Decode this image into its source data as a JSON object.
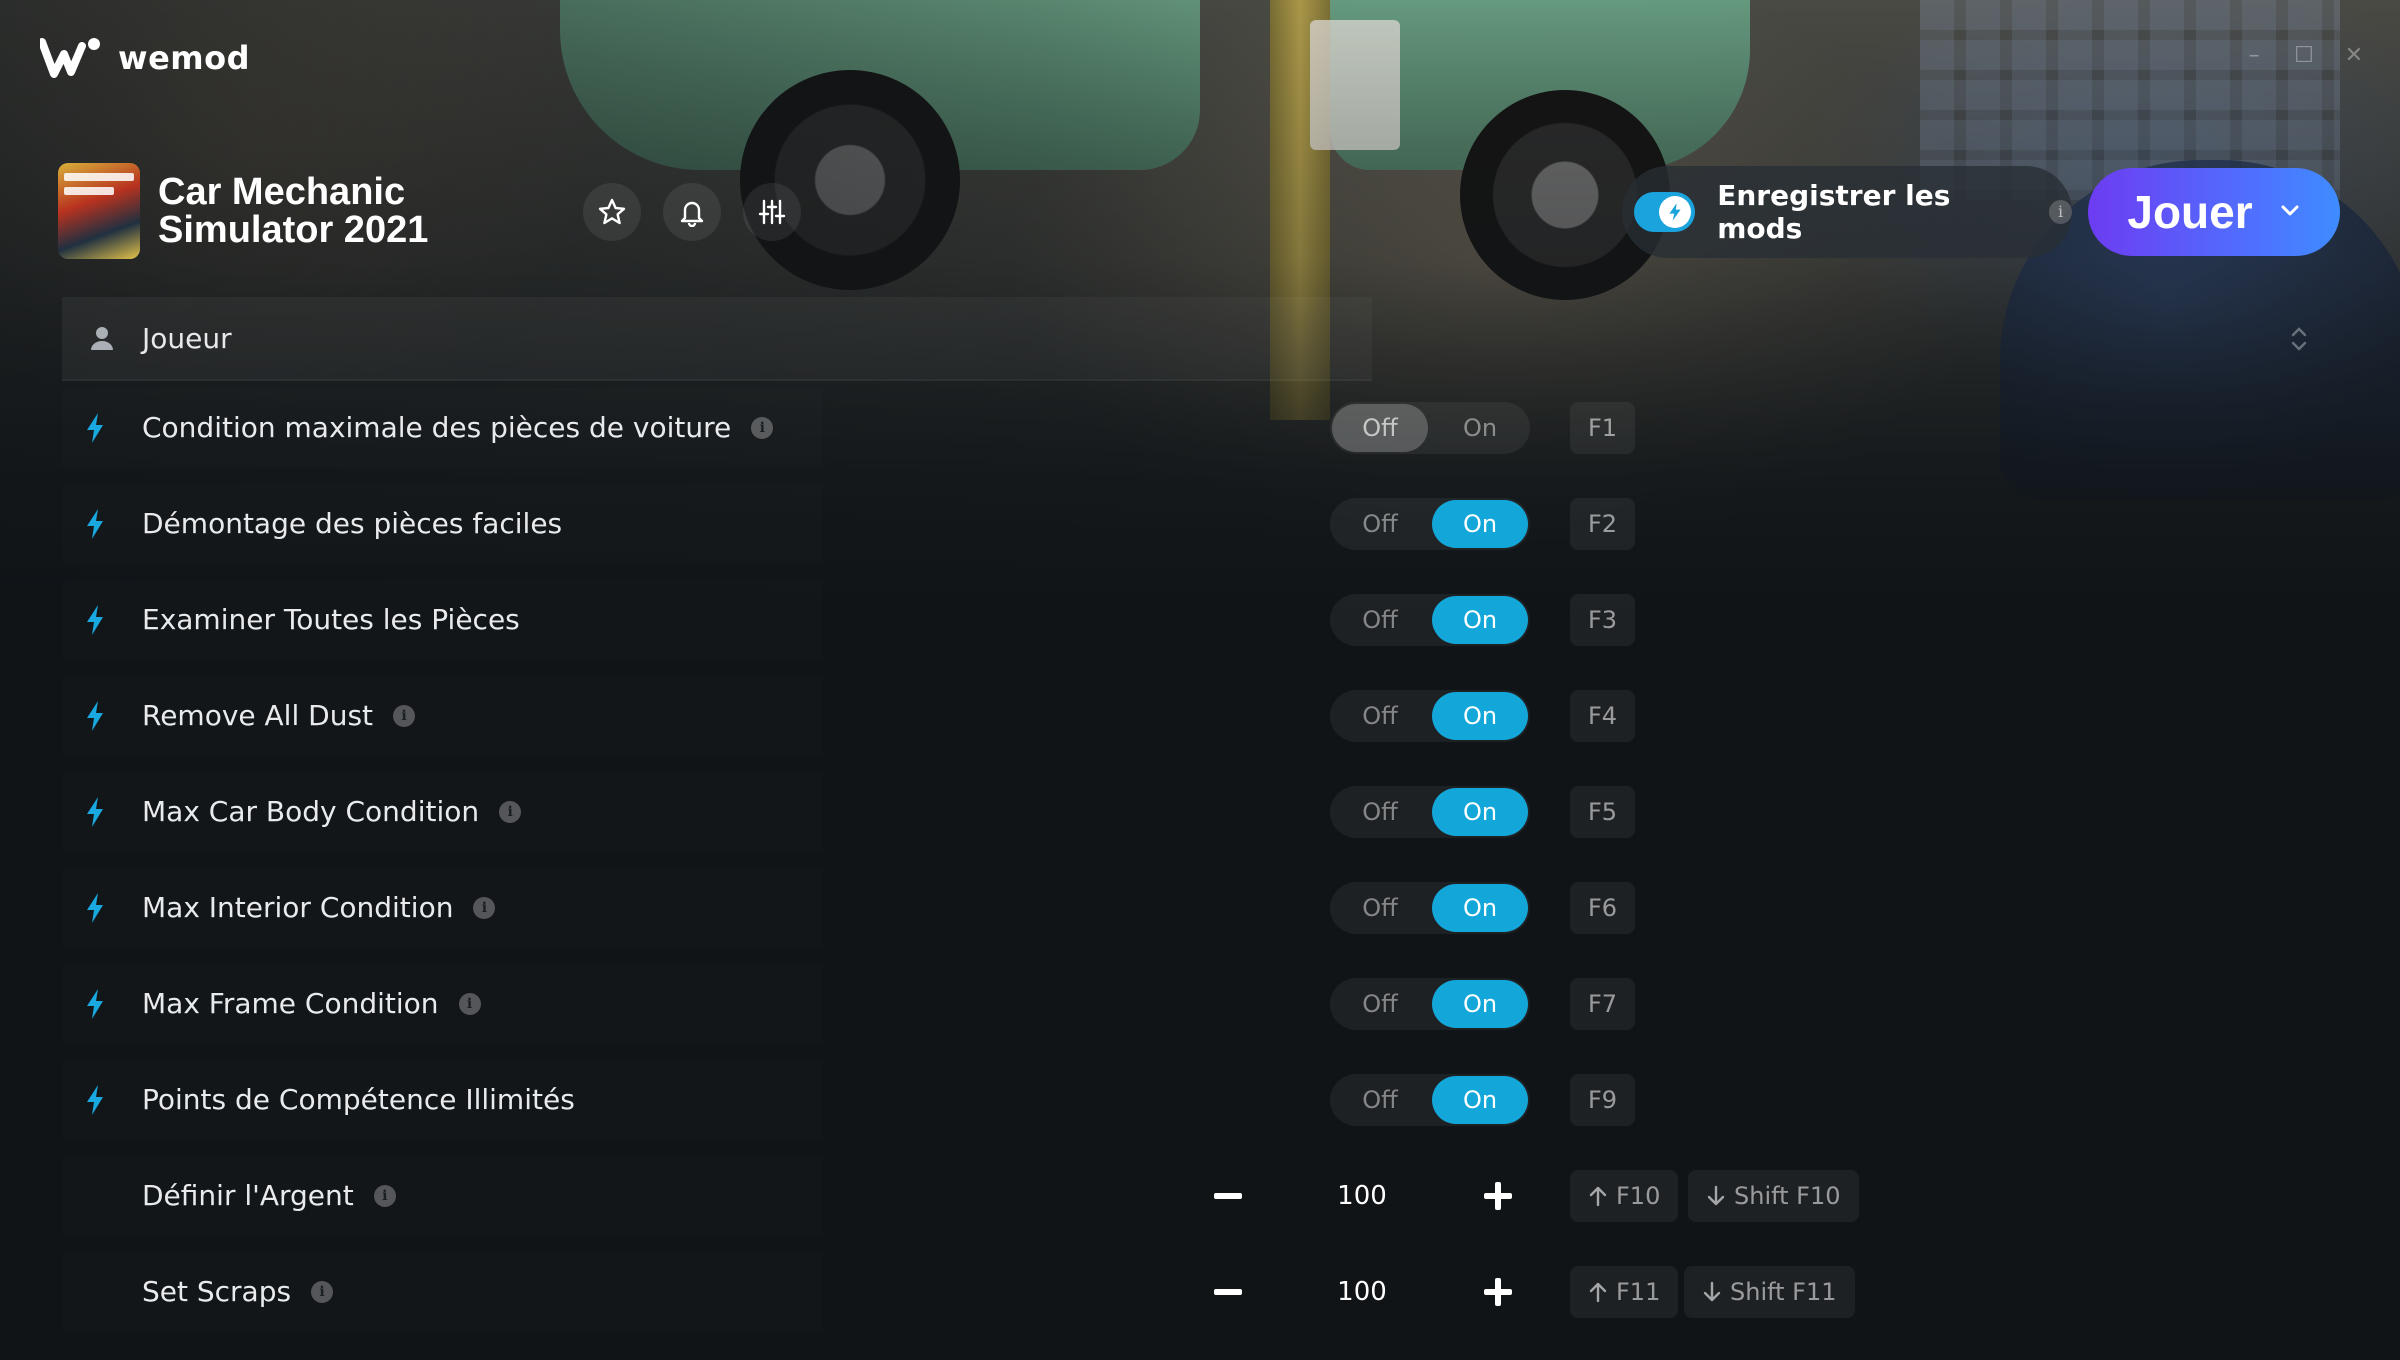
{
  "app": {
    "name": "wemod"
  },
  "window_controls": [
    "minimize",
    "maximize",
    "close"
  ],
  "game": {
    "title": "Car Mechanic Simulator 2021",
    "cover_text": "Car Mechanic Simulator 2021"
  },
  "header_actions": [
    "favorite-star",
    "notifications-bell",
    "settings-sliders"
  ],
  "record_mods": {
    "label": "Enregistrer les mods",
    "enabled": true,
    "info": "i"
  },
  "play": {
    "label": "Jouer"
  },
  "category": {
    "label": "Joueur"
  },
  "toggle_labels": {
    "off": "Off",
    "on": "On"
  },
  "mods": [
    {
      "label": "Condition maximale des pièces de voiture",
      "info": "i",
      "type": "toggle",
      "state": "off",
      "hotkey": "F1"
    },
    {
      "label": "Démontage des pièces faciles",
      "info": "",
      "type": "toggle",
      "state": "on",
      "hotkey": "F2"
    },
    {
      "label": "Examiner Toutes les Pièces",
      "info": "",
      "type": "toggle",
      "state": "on",
      "hotkey": "F3"
    },
    {
      "label": "Remove All Dust",
      "info": "i",
      "type": "toggle",
      "state": "on",
      "hotkey": "F4"
    },
    {
      "label": "Max Car Body Condition",
      "info": "i",
      "type": "toggle",
      "state": "on",
      "hotkey": "F5"
    },
    {
      "label": "Max Interior Condition",
      "info": "i",
      "type": "toggle",
      "state": "on",
      "hotkey": "F6"
    },
    {
      "label": "Max Frame Condition",
      "info": "i",
      "type": "toggle",
      "state": "on",
      "hotkey": "F7"
    },
    {
      "label": "Points de Compétence Illimités",
      "info": "",
      "type": "toggle",
      "state": "on",
      "hotkey": "F9"
    },
    {
      "label": "Définir l'Argent",
      "info": "i",
      "type": "number",
      "value": "100",
      "hotkey_up": "F10",
      "hotkey_down": "Shift F10"
    },
    {
      "label": "Set Scraps",
      "info": "i",
      "type": "number",
      "value": "100",
      "hotkey_up": "F11",
      "hotkey_down": "Shift F11"
    }
  ],
  "colors": {
    "accent": "#12a7d8",
    "play_start": "#6d3cf2",
    "play_end": "#3f8cff",
    "background": "#101417"
  }
}
